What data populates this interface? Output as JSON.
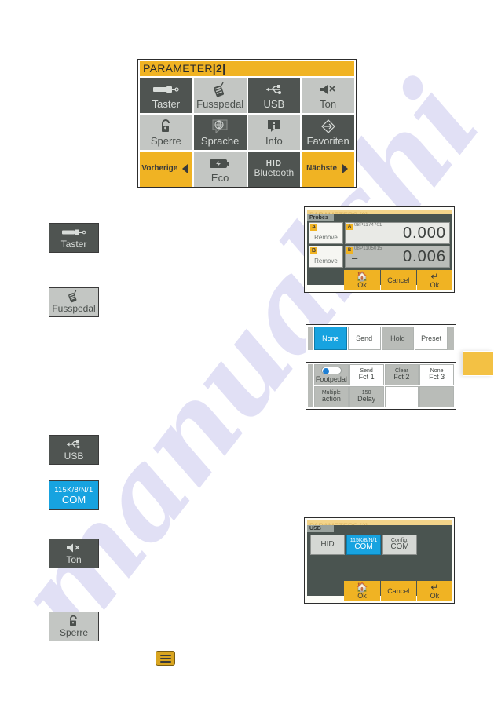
{
  "watermark": {
    "text": "manualshi"
  },
  "param_screen": {
    "header_title": "PARAMETER",
    "header_page": "|2|",
    "tiles": [
      {
        "label": "Taster",
        "icon": "screwdriver-icon",
        "style": "dark"
      },
      {
        "label": "Fusspedal",
        "icon": "footpedal-icon",
        "style": "light"
      },
      {
        "label": "USB",
        "icon": "usb-icon",
        "style": "dark"
      },
      {
        "label": "Ton",
        "icon": "speaker-mute-icon",
        "style": "light"
      },
      {
        "label": "Sperre",
        "icon": "unlock-icon",
        "style": "light"
      },
      {
        "label": "Sprache",
        "icon": "globe-bubble-icon",
        "style": "dark"
      },
      {
        "label": "Info",
        "icon": "info-bubble-icon",
        "style": "light"
      },
      {
        "label": "Favoriten",
        "icon": "diamond-arrow-icon",
        "style": "dark"
      },
      {
        "label": "Vorherige",
        "icon": "chevron-left-icon",
        "style": "amber"
      },
      {
        "label": "Eco",
        "icon": "battery-bolt-icon",
        "style": "light"
      },
      {
        "label": "HID",
        "label2": "Bluetooth",
        "icon": "none",
        "style": "dark"
      },
      {
        "label": "Nächste",
        "icon": "chevron-right-icon",
        "style": "amber"
      }
    ]
  },
  "side_buttons": [
    {
      "label": "Taster",
      "icon": "screwdriver-icon",
      "style": "dark"
    },
    {
      "label": "Fusspedal",
      "icon": "footpedal-icon",
      "style": "light"
    },
    {
      "label": "USB",
      "icon": "usb-icon",
      "style": "dark"
    },
    {
      "label_top": "115K/8/N/1",
      "label": "COM",
      "icon": "none",
      "style": "blue"
    },
    {
      "label": "Ton",
      "icon": "speaker-mute-icon",
      "style": "dark"
    },
    {
      "label": "Sperre",
      "icon": "unlock-icon",
      "style": "light"
    }
  ],
  "probe_dialog": {
    "bg_header": "PARAMETERS [2]",
    "title": "Probes",
    "rows": [
      {
        "tag": "A",
        "remove_label": "Remove",
        "serial": "08P1174701",
        "value": "0.000",
        "sign": ""
      },
      {
        "tag": "B",
        "remove_label": "Remove",
        "serial": "08P1105015",
        "value": "0.006",
        "sign": "–"
      }
    ],
    "footer": [
      {
        "label": "Ok",
        "glyph": "home-icon"
      },
      {
        "label": "Cancel",
        "glyph": "none"
      },
      {
        "label": "Ok",
        "glyph": "enter-icon"
      }
    ]
  },
  "mode_strip": {
    "buttons": [
      {
        "label": "None",
        "state": "selected"
      },
      {
        "label": "Send",
        "state": "normal"
      },
      {
        "label": "Hold",
        "state": "gray"
      },
      {
        "label": "Preset",
        "state": "normal"
      }
    ]
  },
  "fct_panel": {
    "cells": [
      {
        "type": "toggle",
        "label": "Footpedal"
      },
      {
        "top": "Send",
        "label": "Fct 1",
        "style": "white"
      },
      {
        "top": "Clear",
        "label": "Fct 2",
        "style": "gray"
      },
      {
        "top": "None",
        "label": "Fct 3",
        "style": "white"
      },
      {
        "top": "Multiple",
        "label": "action",
        "style": "gray"
      },
      {
        "top": "150",
        "label": "Delay",
        "style": "gray"
      },
      {
        "top": "",
        "label": "",
        "style": "white"
      },
      {
        "top": "",
        "label": "",
        "style": "gray"
      }
    ]
  },
  "usb_dialog": {
    "bg_header": "PARAMETERS [2]",
    "title": "USB",
    "options": [
      {
        "top": "",
        "label": "HID",
        "state": "normal"
      },
      {
        "top": "115K/8/N/1",
        "label": "COM",
        "state": "selected"
      },
      {
        "top": "Config.",
        "label": "COM",
        "state": "normal"
      }
    ],
    "footer": [
      {
        "label": "Ok",
        "glyph": "home-icon"
      },
      {
        "label": "Cancel",
        "glyph": "none"
      },
      {
        "label": "Ok",
        "glyph": "enter-icon"
      }
    ]
  },
  "edge_tab": {
    "name": "page-edge-tab"
  },
  "menu_chip": {
    "name": "hamburger-menu-icon"
  },
  "colors": {
    "amber": "#f0b323",
    "dark_tile": "#4f5451",
    "light_tile": "#c3c6c3",
    "blue_selected": "#17a3e0",
    "dialog_bg": "#4a5450"
  }
}
